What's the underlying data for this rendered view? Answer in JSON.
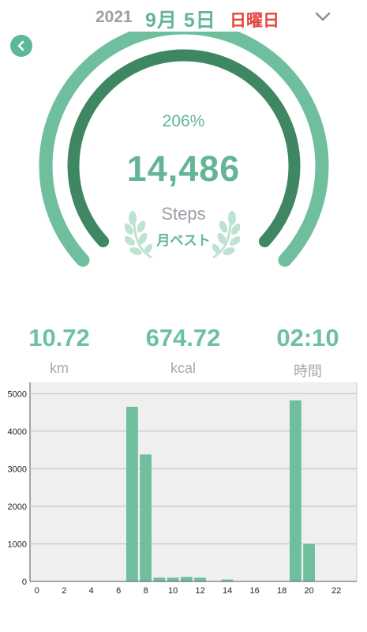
{
  "header": {
    "year": "2021",
    "month_day": "9月 5日",
    "weekday": "日曜日",
    "expand_icon": "chevron-down-icon",
    "back_icon": "back-arrow-icon"
  },
  "goal_ring": {
    "percent_label": "206%",
    "steps": "14,486",
    "unit": "Steps",
    "badge": "月ベスト",
    "outer_progress": 1.0,
    "inner_progress": 1.0,
    "colors": {
      "outer": "#6fbf9f",
      "inner": "#3f8762",
      "laurel": "#bfe3d3"
    }
  },
  "stats": [
    {
      "value": "10.72",
      "unit": "km"
    },
    {
      "value": "674.72",
      "unit": "kcal"
    },
    {
      "value": "02:10",
      "unit": "時間"
    }
  ],
  "chart_data": {
    "type": "bar",
    "x": [
      0,
      1,
      2,
      3,
      4,
      5,
      6,
      7,
      8,
      9,
      10,
      11,
      12,
      13,
      14,
      15,
      16,
      17,
      18,
      19,
      20,
      21,
      22,
      23
    ],
    "values": [
      0,
      0,
      0,
      0,
      0,
      0,
      0,
      4650,
      3380,
      100,
      100,
      120,
      100,
      0,
      50,
      0,
      0,
      0,
      0,
      4820,
      1000,
      0,
      0,
      0
    ],
    "xticks": [
      "0",
      "2",
      "4",
      "6",
      "8",
      "10",
      "12",
      "14",
      "16",
      "18",
      "20",
      "22"
    ],
    "yticks": [
      "0",
      "1000",
      "2000",
      "3000",
      "4000",
      "5000"
    ],
    "ylim": [
      0,
      5300
    ],
    "xlim": [
      -0.5,
      23.5
    ],
    "grid": true,
    "color": "#6fbf9f",
    "background": "#efefef"
  }
}
